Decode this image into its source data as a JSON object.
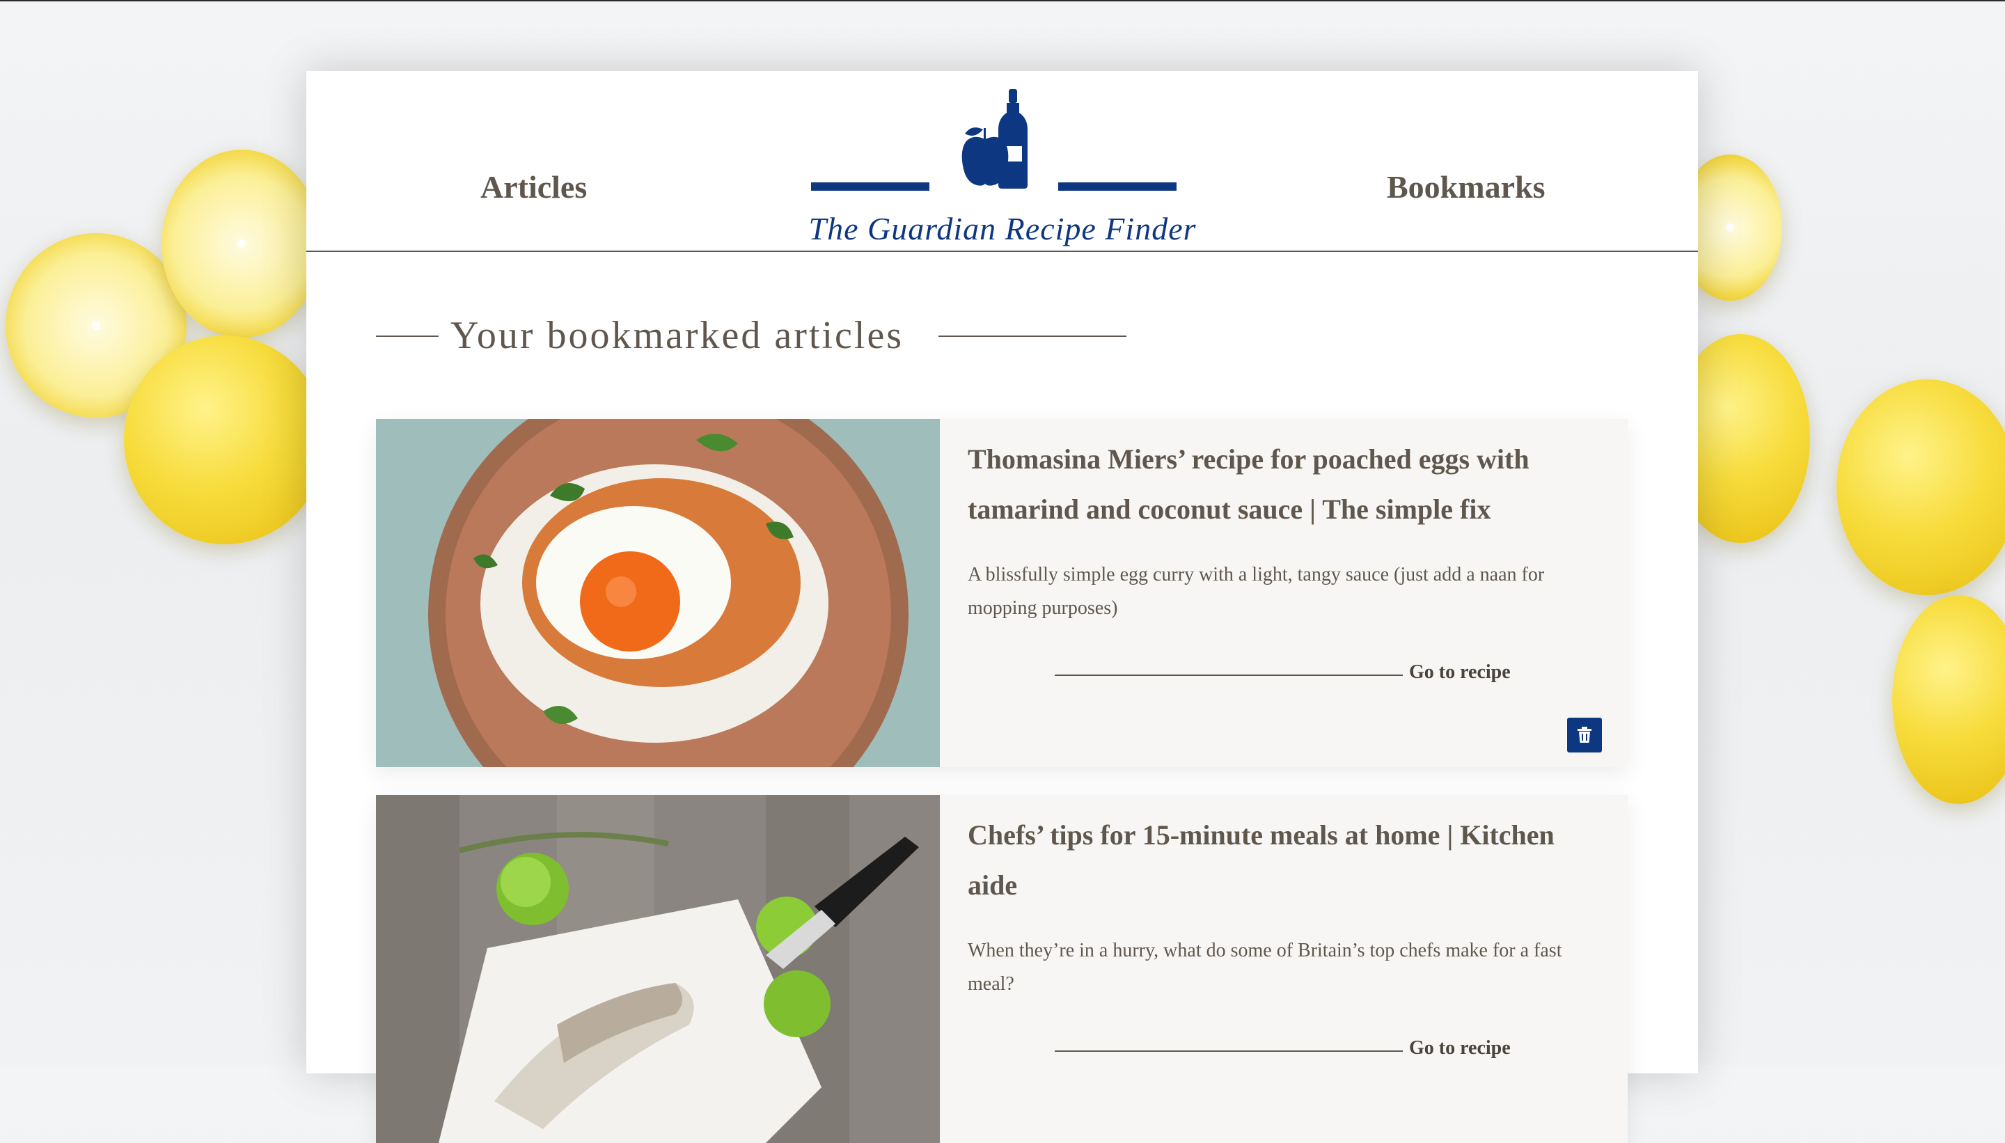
{
  "nav": {
    "articles_label": "Articles",
    "bookmarks_label": "Bookmarks"
  },
  "brand": {
    "title": "The Guardian Recipe Finder",
    "logo_icon": "apple-and-bottle-icon",
    "color": "#0e3781"
  },
  "page": {
    "section_title": "Your bookmarked articles"
  },
  "articles": [
    {
      "title": "Thomasina Miers’ recipe for poached eggs with tamarind and coconut sauce | The simple fix",
      "description": "A blissfully simple egg curry with a light, tangy sauce (just add a naan for mopping purposes)",
      "link_label": "Go to recipe",
      "delete_icon": "trash-icon"
    },
    {
      "title": "Chefs’ tips for 15-minute meals at home | Kitchen aide",
      "description": "When they’re in a hurry, what do some of Britain’s top chefs make for a fast meal?",
      "link_label": "Go to recipe"
    }
  ],
  "colors": {
    "text": "#5f574d",
    "accent": "#0e3781",
    "card_bg": "#f7f6f4"
  }
}
